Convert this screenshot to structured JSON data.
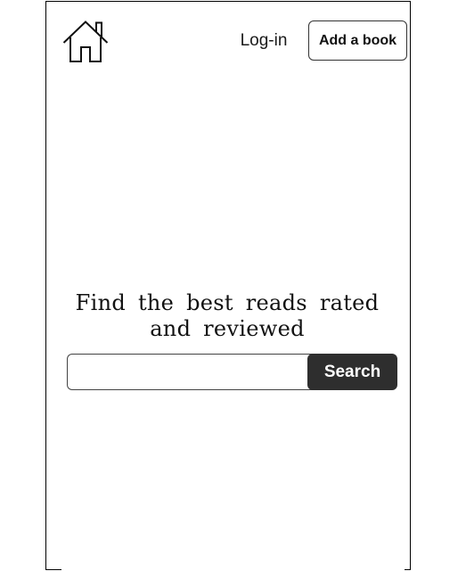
{
  "header": {
    "home_icon": "home-icon",
    "login_label": "Log-in",
    "add_book_label": "Add a book"
  },
  "hero": {
    "tagline": "Find the best reads rated and reviewed"
  },
  "search": {
    "input_value": "",
    "button_label": "Search"
  },
  "colors": {
    "search_button_bg": "#2e2e2e",
    "search_button_text": "#ffffff",
    "border": "#333333"
  }
}
